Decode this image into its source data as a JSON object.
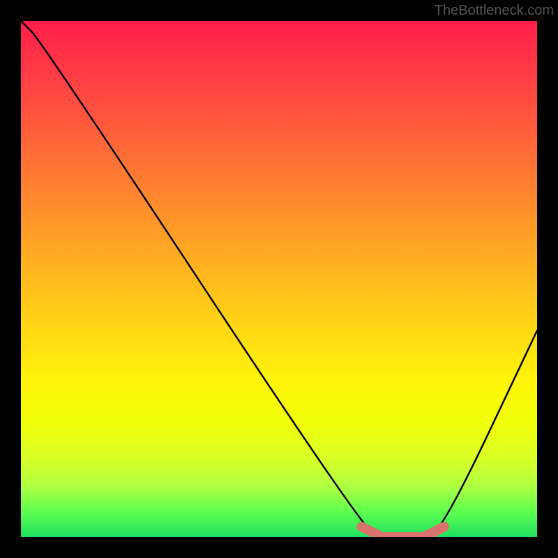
{
  "watermark": "TheBottleneck.com",
  "chart_data": {
    "type": "line",
    "title": "",
    "xlabel": "",
    "ylabel": "",
    "xlim": [
      0,
      100
    ],
    "ylim": [
      0,
      100
    ],
    "series": [
      {
        "name": "bottleneck-curve",
        "x": [
          0,
          4,
          66,
          70,
          78,
          82,
          100
        ],
        "values": [
          100,
          96,
          2,
          0,
          0,
          2,
          40
        ]
      }
    ],
    "highlight_region": {
      "x_start": 66,
      "x_end": 82,
      "color": "#d9736b"
    },
    "gradient_stops": [
      {
        "pos": 0,
        "color": "#ff1f4a"
      },
      {
        "pos": 50,
        "color": "#ffba1e"
      },
      {
        "pos": 78,
        "color": "#f0ff0a"
      },
      {
        "pos": 100,
        "color": "#20e060"
      }
    ]
  }
}
